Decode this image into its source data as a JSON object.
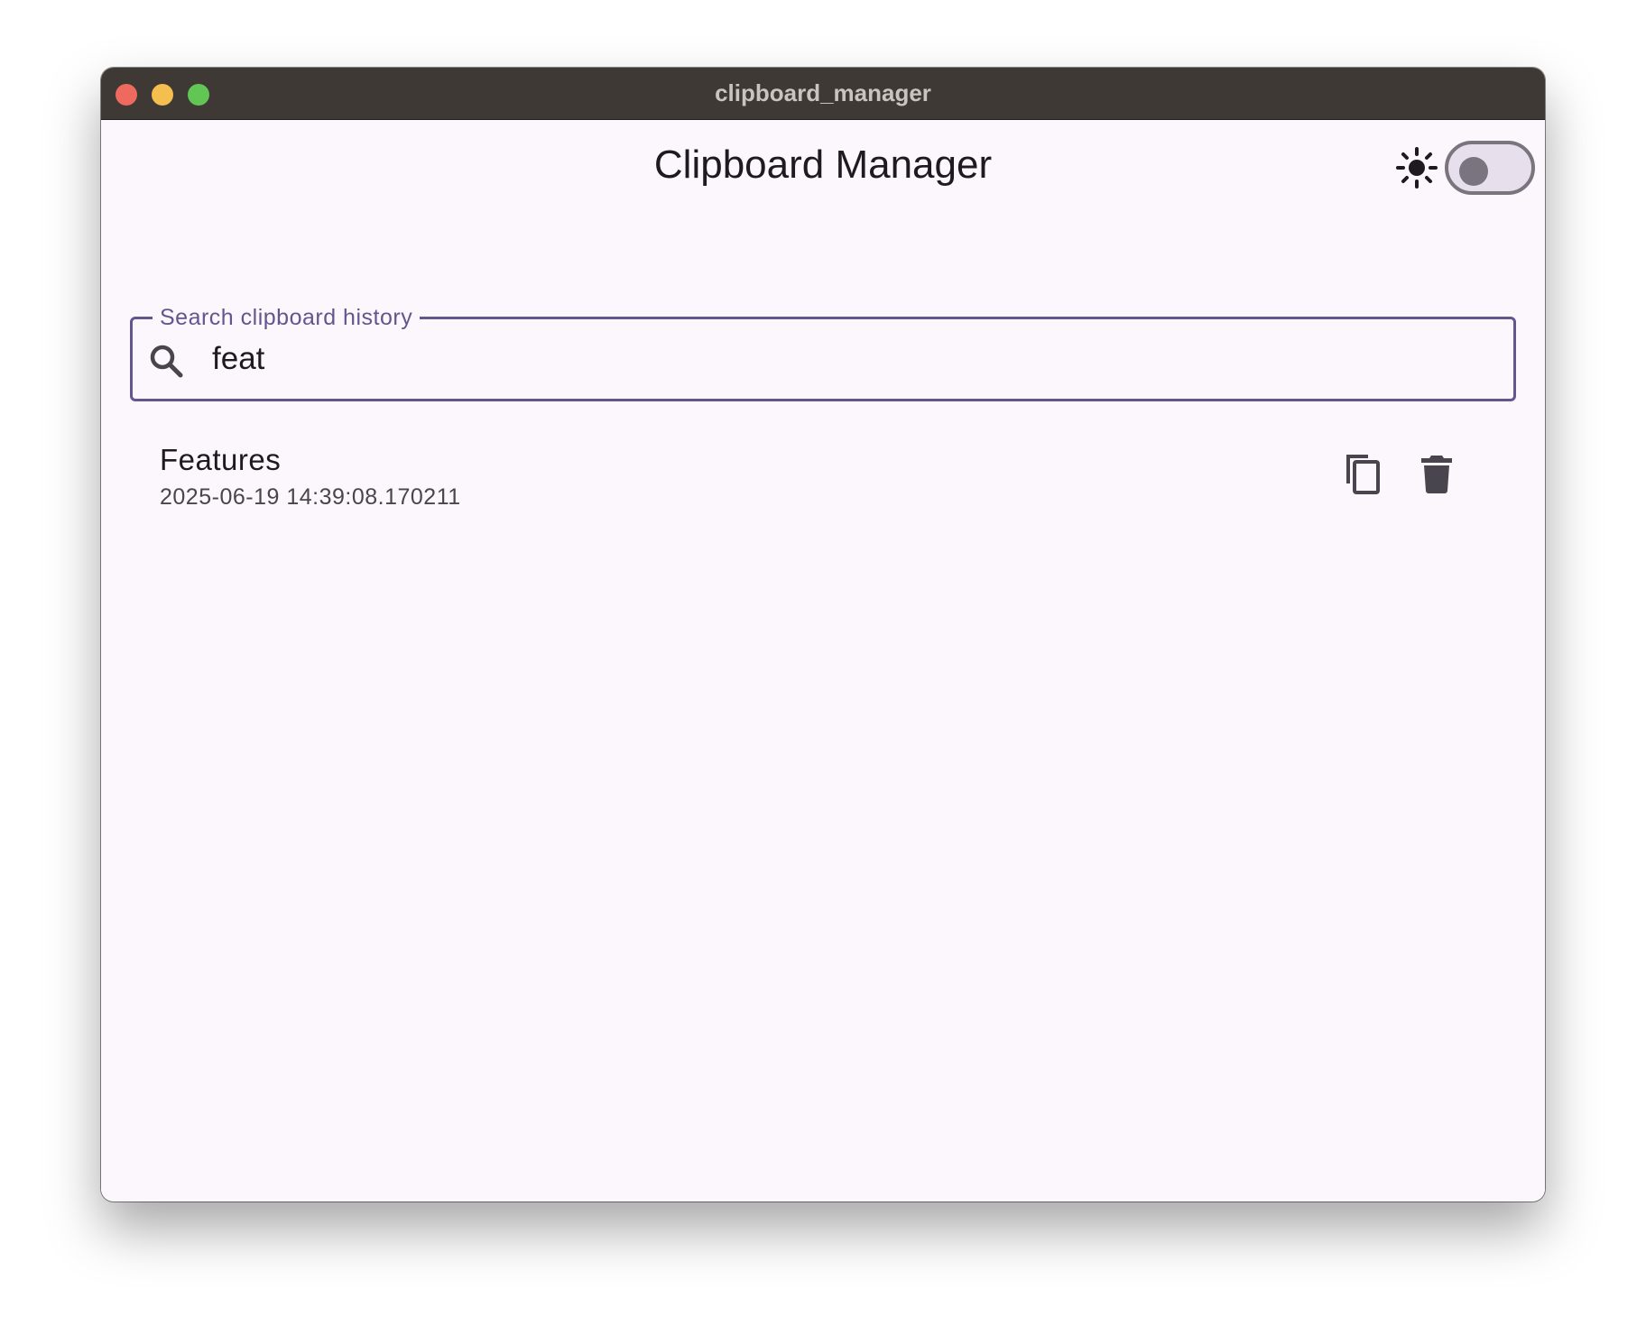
{
  "window": {
    "title": "clipboard_manager"
  },
  "app": {
    "title": "Clipboard Manager"
  },
  "theme_toggle": {
    "state": "off",
    "icon": "sun-icon"
  },
  "search": {
    "label": "Search clipboard history",
    "value": "feat",
    "icon": "search-icon"
  },
  "clipboard_items": [
    {
      "title": "Features",
      "timestamp": "2025-06-19 14:39:08.170211",
      "actions": [
        "copy-icon",
        "delete-icon"
      ]
    }
  ],
  "colors": {
    "accent": "#65558f",
    "background": "#fcf7fc",
    "titlebar": "#3e3935",
    "text": "#1d1b20",
    "icon": "#49454f"
  }
}
